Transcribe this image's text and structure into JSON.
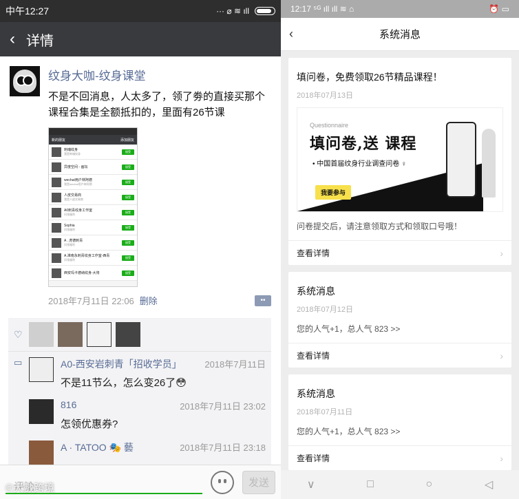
{
  "left": {
    "status": {
      "time": "中午12:27",
      "icons": "··· ⌀ ≋ ıll"
    },
    "header": {
      "back": "‹",
      "title": "详情"
    },
    "post": {
      "author": "纹身大咖-纹身课堂",
      "text": "不是不回消息，人太多了，领了劵的直接买那个课程合集是全额抵扣的，里面有26节课",
      "image": {
        "header_left": "新的朋友",
        "header_right": "添加朋友",
        "rows": [
          {
            "name": "刺魂纹身",
            "sub": "我是刺魂纹身",
            "btn": "接受"
          },
          {
            "name": "异度空间 - 画坛",
            "sub": "",
            "btn": "接受"
          },
          {
            "name": "wechat用户林阿德",
            "sub": "我是wechat用户林阿德",
            "btn": "接受"
          },
          {
            "name": "人皮交易商",
            "sub": "我是人皮交易商",
            "btn": "接受"
          },
          {
            "name": "A0刺青纹身工作室",
            "sub": "问领福利",
            "btn": "接受"
          },
          {
            "name": "Sophia",
            "sub": "问领福利",
            "btn": "接受"
          },
          {
            "name": "A . 虎德刺青",
            "sub": "问领福利",
            "btn": "接受"
          },
          {
            "name": "A.淮南永刺青纹身工作室-西青",
            "sub": "问领福利",
            "btn": "接受"
          },
          {
            "name": "西安玛卡德纳纹身-大将",
            "sub": "",
            "btn": "接受"
          }
        ]
      },
      "time": "2018年7月11日 22:06",
      "delete": "删除",
      "more": "••"
    },
    "comments": [
      {
        "name": "A0-西安岩刺青「招收学员」",
        "time": "2018年7月11日",
        "text": "不是11节么，怎么变26了😳"
      },
      {
        "name": "816",
        "time": "2018年7月11日 23:02",
        "text": "怎领优惠券?"
      },
      {
        "name": "A · TATOO 🎭 藝",
        "time": "2018年7月11日 23:18",
        "text": ""
      }
    ],
    "input": {
      "placeholder": "评论",
      "send": "发送"
    },
    "watermark": "©大數跨境"
  },
  "right": {
    "status": {
      "time": "12:17 ⁵ᴳ ıll ıll ≋ ⌂",
      "icons": "⏰ ▭"
    },
    "header": {
      "back": "‹",
      "title": "系统消息"
    },
    "cards": [
      {
        "title": "填问卷，免费领取26节精品课程！",
        "date": "2018年07月13日",
        "banner": {
          "questionnaire": "Questionnaire",
          "big": "填问卷,送 课程",
          "sub": "• 中国首届纹身行业调查问卷 ♀",
          "join": "我要参与"
        },
        "text": "问卷提交后，请注意领取方式和领取口号哦！",
        "link": "查看详情"
      },
      {
        "title": "系统消息",
        "date": "2018年07月12日",
        "text": "您的人气+1，总人气 823 >>",
        "link": "查看详情"
      },
      {
        "title": "系统消息",
        "date": "2018年07月11日",
        "text": "您的人气+1，总人气 823 >>",
        "link": "查看详情"
      }
    ],
    "nav": [
      "∨",
      "□",
      "○",
      "◁"
    ]
  }
}
